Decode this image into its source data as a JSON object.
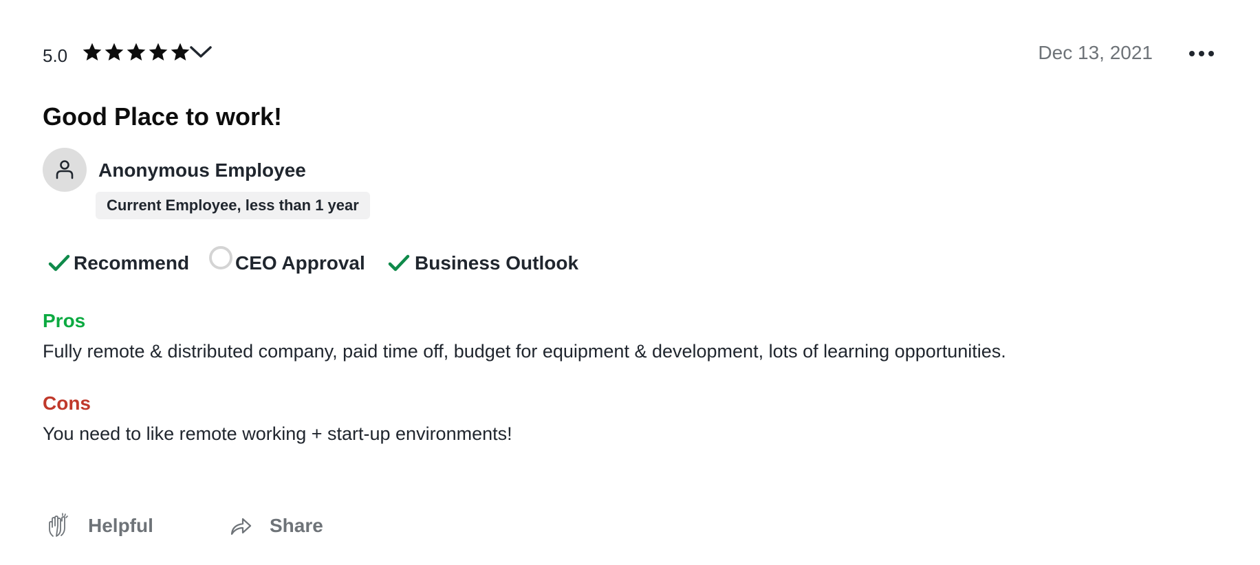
{
  "review": {
    "rating": "5.0",
    "stars": 5,
    "date": "Dec 13, 2021",
    "title": "Good Place to work!",
    "author": "Anonymous Employee",
    "employee_status": "Current Employee, less than 1 year",
    "sub_ratings": [
      {
        "label": "Recommend",
        "status": "positive",
        "icon": "check-icon"
      },
      {
        "label": "CEO Approval",
        "status": "no-opinion",
        "icon": "circle-outline-icon"
      },
      {
        "label": "Business Outlook",
        "status": "positive",
        "icon": "check-icon"
      }
    ],
    "pros_label": "Pros",
    "pros_text": "Fully remote & distributed company, paid time off, budget for equipment & development, lots of learning opportunities.",
    "cons_label": "Cons",
    "cons_text": "You need to like remote working + start-up environments!",
    "actions": {
      "helpful_label": "Helpful",
      "share_label": "Share"
    }
  },
  "colors": {
    "text": "#20262e",
    "muted": "#6e7378",
    "positive": "#0caa41",
    "check": "#0f8a4a",
    "negative": "#c0392b",
    "avatar_bg": "#dedede",
    "badge_bg": "#f1f1f2"
  },
  "icons": [
    "star-icon",
    "chevron-down-icon",
    "more-dots-icon",
    "person-icon",
    "check-icon",
    "circle-outline-icon",
    "clap-icon",
    "share-arrow-icon"
  ]
}
